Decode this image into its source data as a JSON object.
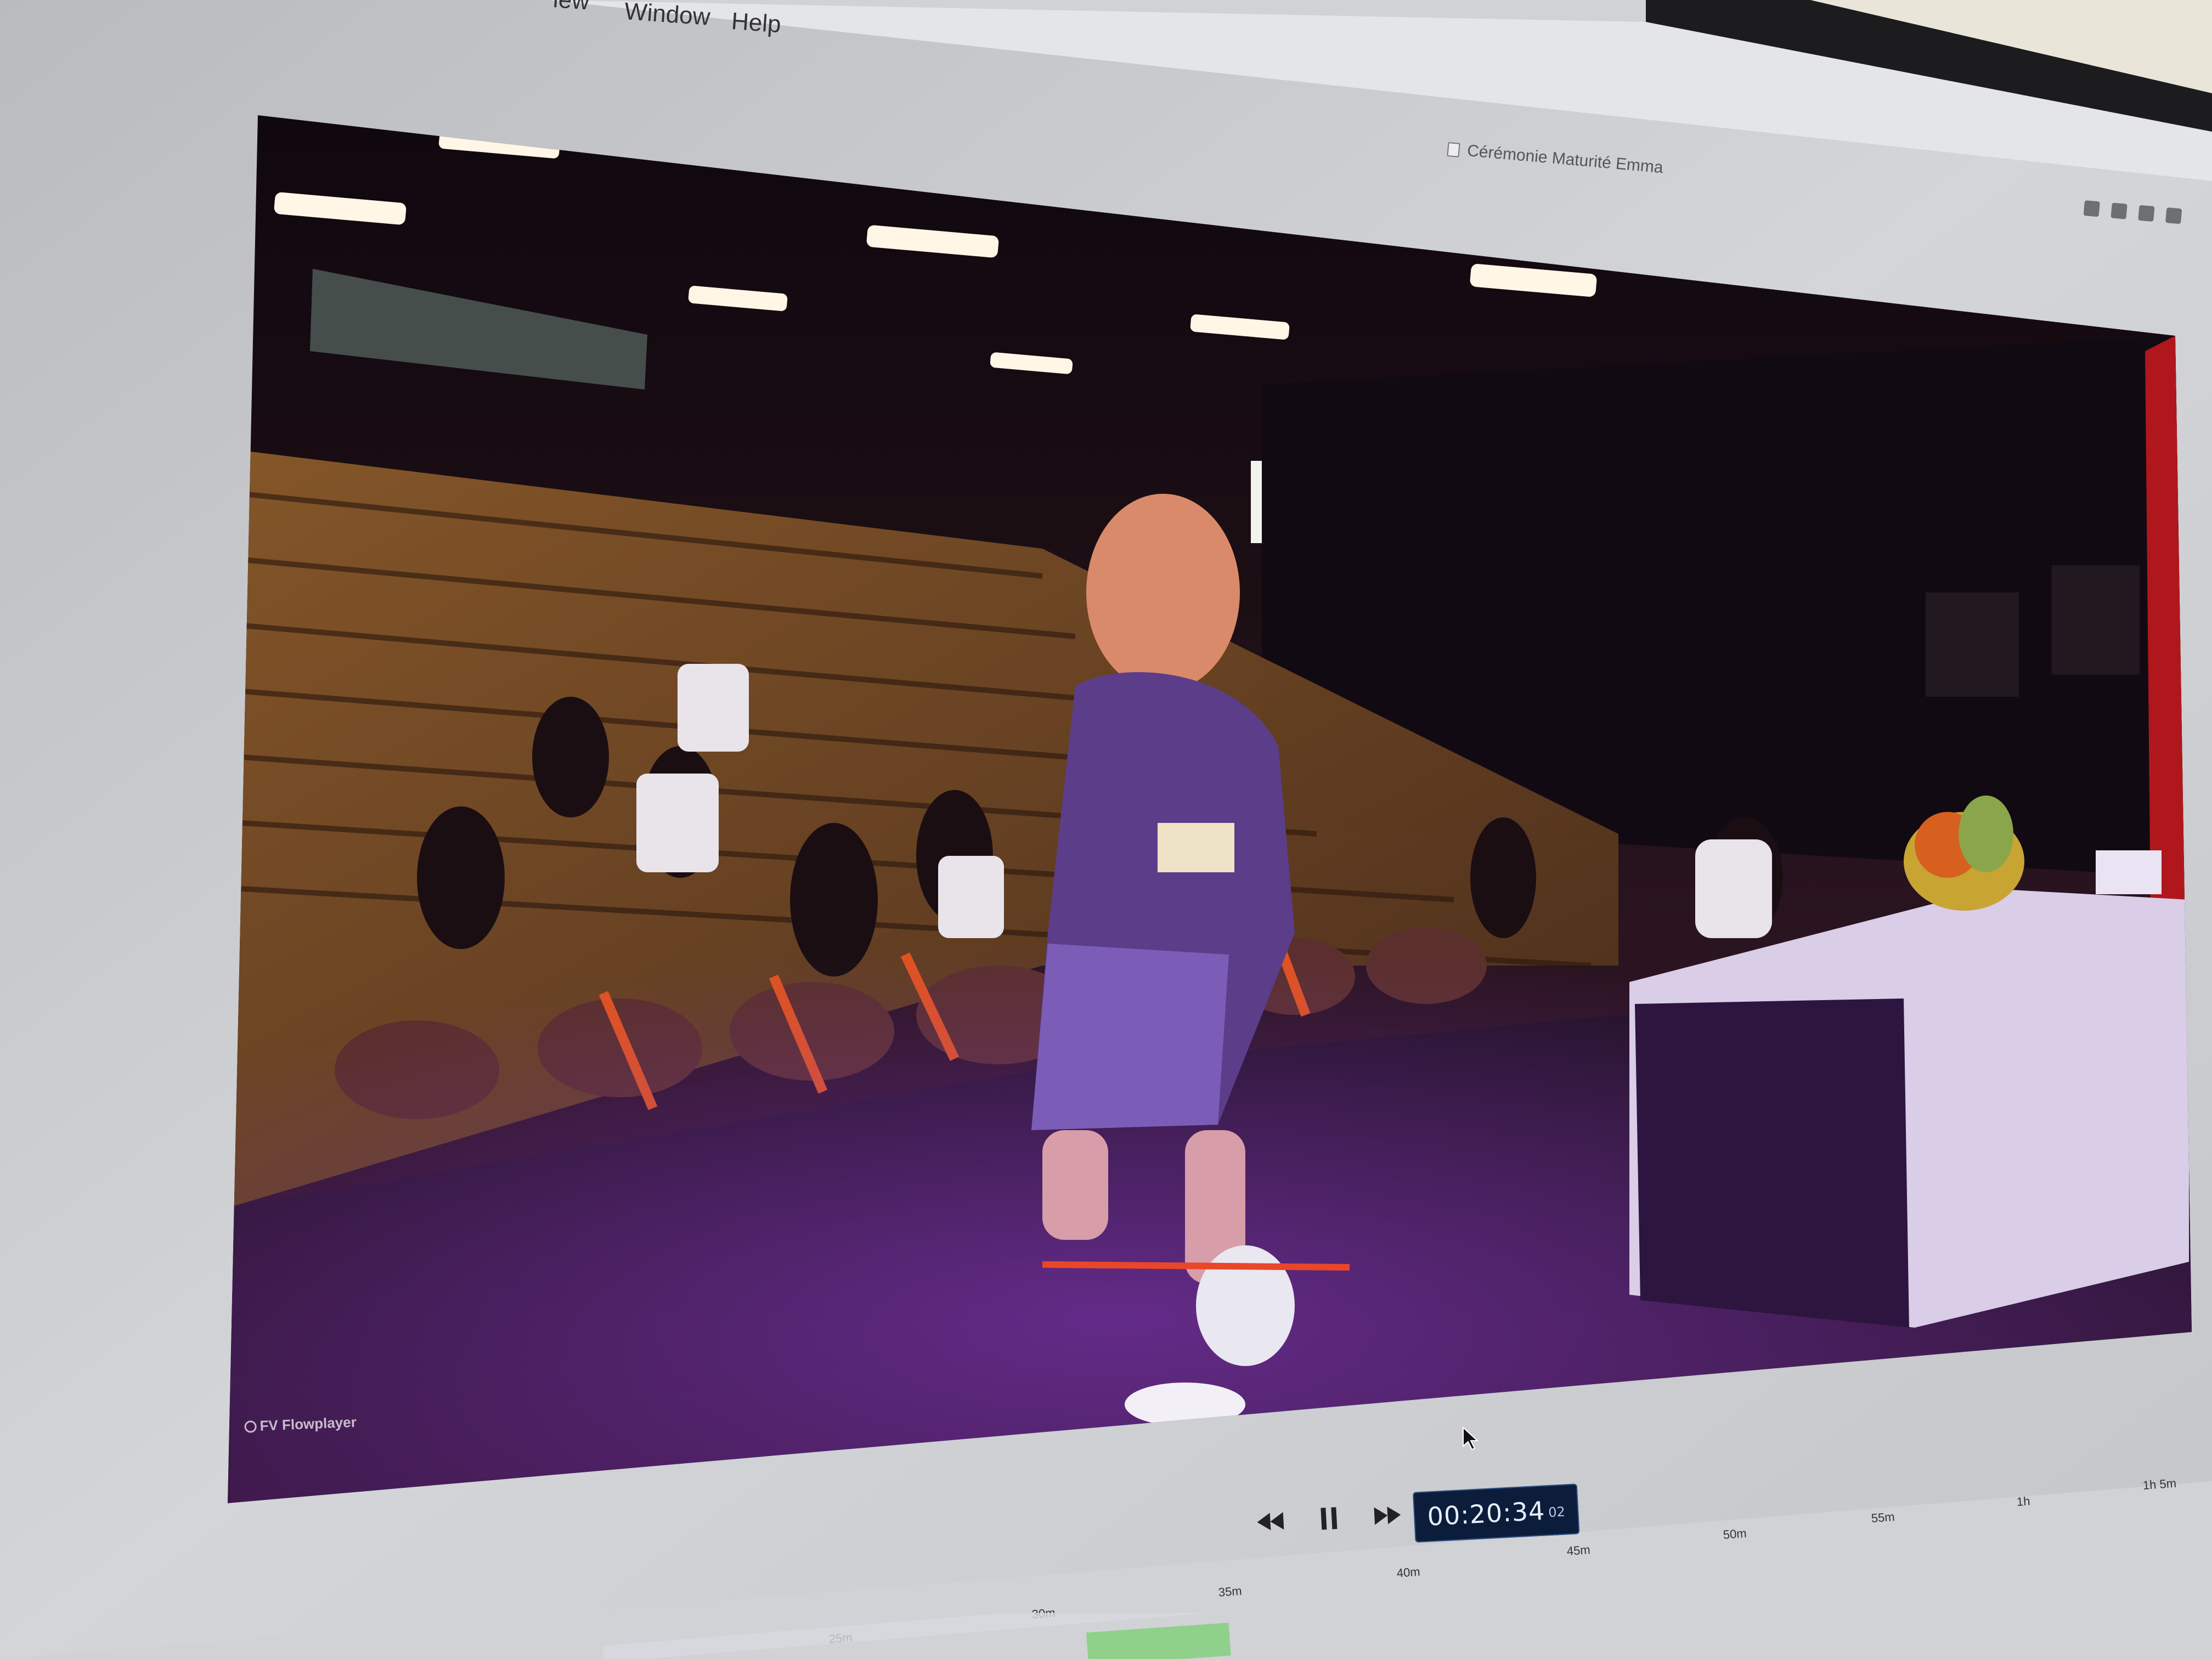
{
  "menu_bar": {
    "items": [
      "iew",
      "Window",
      "Help"
    ]
  },
  "window": {
    "title": "Cérémonie Maturité Emma"
  },
  "status_icons": [
    "screen-record-icon",
    "dropbox-icon",
    "sync-icon",
    "display-icon",
    "more-icon"
  ],
  "player": {
    "watermark": "FV Flowplayer"
  },
  "transport": {
    "rewind_icon": "rewind-icon",
    "pause_icon": "pause-icon",
    "forward_icon": "fast-forward-icon"
  },
  "timecode": {
    "main": "00:20:34",
    "frames": "02"
  },
  "timeline": {
    "labels": [
      "25m",
      "30m",
      "35m",
      "40m",
      "45m",
      "50m",
      "55m",
      "1h",
      "1h 5m"
    ]
  },
  "colors": {
    "bezel": "#c9cbcf",
    "video_bg": "#1a0d1e",
    "timecode_bg": "#0b1d3a"
  }
}
